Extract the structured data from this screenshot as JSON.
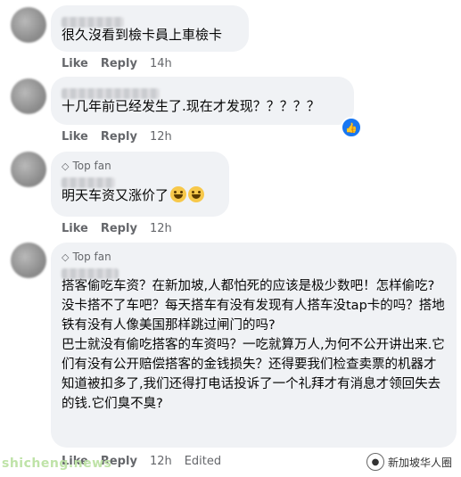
{
  "comments": [
    {
      "top_fan": "",
      "text": "很久沒看到檢卡員上車檢卡",
      "like": "Like",
      "reply": "Reply",
      "time": "14h",
      "edited": ""
    },
    {
      "top_fan": "",
      "text": "十几年前已经发生了.现在才发现？？？？？",
      "like": "Like",
      "reply": "Reply",
      "time": "12h",
      "edited": "",
      "reaction_icon": "like-icon"
    },
    {
      "top_fan": "Top fan",
      "text": "明天车资又涨价了",
      "like": "Like",
      "reply": "Reply",
      "time": "12h",
      "edited": ""
    },
    {
      "top_fan": "Top fan",
      "text": "搭客偷吃车资？在新加坡,人都怕死的应该是极少数吧！怎样偷吃?没卡搭不了车吧？每天搭车有没有发现有人搭车没tap卡的吗？搭地铁有没有人像美国那样跳过闸门的吗?\n巴士就没有偷吃搭客的车资吗？一吃就算万人,为何不公开讲出来.它们有没有公开赔偿搭客的金钱损失？还得要我们检查卖票的机器才知道被扣多了,我们还得打电话投诉了一个礼拜才有消息才领回失去的钱.它们臭不臭?",
      "like": "Like",
      "reply": "Reply",
      "time": "12h",
      "edited": "Edited"
    }
  ],
  "watermark_left": "shicheng.news",
  "watermark_right": "新加坡华人圈",
  "colors": {
    "bubble": "#f0f2f5",
    "meta": "#65676b",
    "reaction": "#1877f2"
  }
}
